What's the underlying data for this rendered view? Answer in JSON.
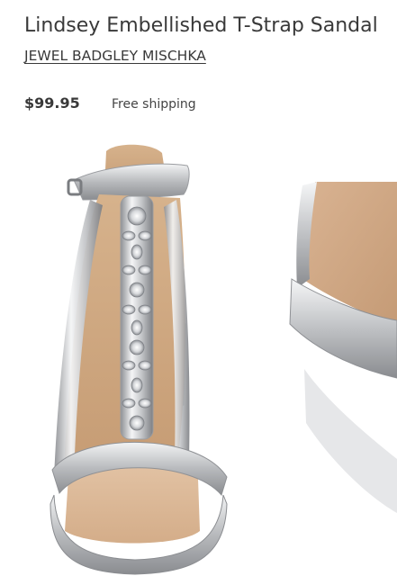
{
  "product": {
    "title": "Lindsey Embellished T-Strap Sandal",
    "brand": "JEWEL BADGLEY MISCHKA",
    "price": "$99.95",
    "shipping": "Free shipping"
  },
  "gallery": {
    "images": [
      {
        "name": "sandal-front-view"
      },
      {
        "name": "sandal-detail-closeup"
      }
    ]
  },
  "colors": {
    "text": "#393939",
    "silver": "#c9cbce",
    "cork": "#c9a27c"
  }
}
